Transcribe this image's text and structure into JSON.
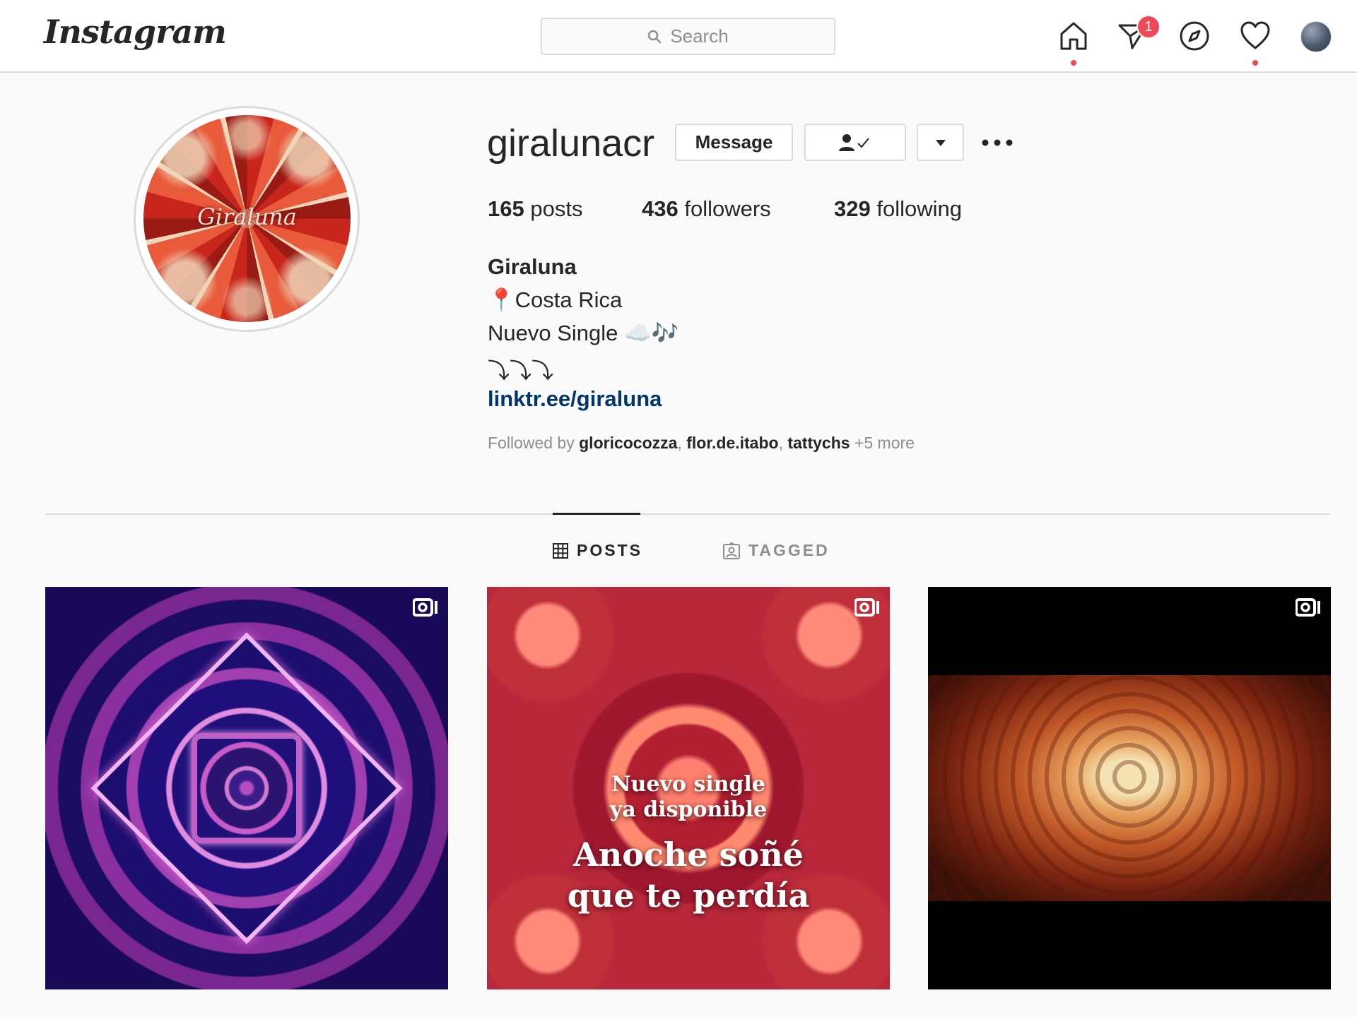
{
  "header": {
    "logo": "Instagram",
    "search_placeholder": "Search",
    "notification_count": "1"
  },
  "profile": {
    "avatar_text": "Giraluna",
    "username": "giralunacr",
    "message_button": "Message",
    "stats": {
      "posts_count": "165",
      "posts_label": "posts",
      "followers_count": "436",
      "followers_label": "followers",
      "following_count": "329",
      "following_label": "following"
    },
    "bio": {
      "name": "Giraluna",
      "location": "📍Costa Rica",
      "line2": "Nuevo Single ☁️🎶",
      "arrows": "⤵⤵⤵",
      "link": "linktr.ee/giraluna"
    },
    "followed_by": {
      "prefix": "Followed by",
      "user1": "gloricocozza",
      "user2": "flor.de.itabo",
      "user3": "tattychs",
      "more": "+5 more"
    }
  },
  "tabs": {
    "posts": "POSTS",
    "tagged": "TAGGED"
  },
  "posts": {
    "p2_line1": "Nuevo single",
    "p2_line2": "ya disponible",
    "p2_line3": "Anoche soñé",
    "p2_line4": "que te perdía"
  },
  "icons": {
    "home": "home-icon",
    "direct": "direct-icon",
    "explore": "compass-icon",
    "activity": "heart-icon",
    "video": "igtv-icon"
  },
  "colors": {
    "link": "#00376b",
    "badge": "#ed4956",
    "muted": "#8e8e8e"
  }
}
